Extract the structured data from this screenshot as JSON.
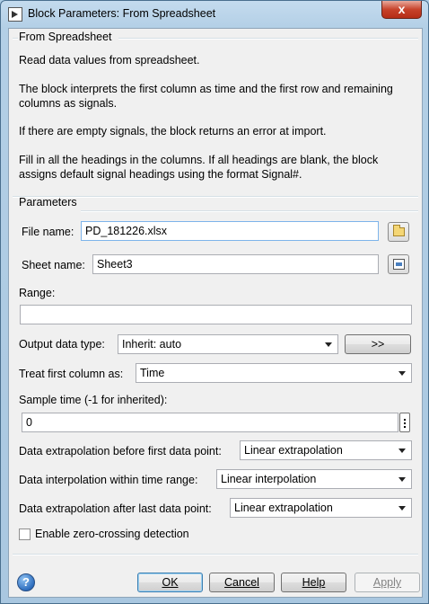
{
  "window": {
    "title": "Block Parameters: From Spreadsheet",
    "close_glyph": "x"
  },
  "block_group": {
    "title": "From Spreadsheet",
    "descriptions": [
      "Read data values from spreadsheet.",
      "The block interprets the first column as time and the first row and remaining columns as signals.",
      "If there are empty signals, the block returns an error at import.",
      "Fill in all the headings in the columns. If all headings are blank, the block assigns default signal headings using the format Signal#."
    ]
  },
  "parameters": {
    "title": "Parameters",
    "file_name_label": "File name:",
    "file_name_value": "PD_181226.xlsx",
    "sheet_name_label": "Sheet name:",
    "sheet_name_value": "Sheet3",
    "range_label": "Range:",
    "range_value": "",
    "output_type_label": "Output data type:",
    "output_type_value": "Inherit: auto",
    "output_type_button": ">>",
    "treat_first_col_label": "Treat first column as:",
    "treat_first_col_value": "Time",
    "sample_time_label": "Sample time (-1 for inherited):",
    "sample_time_value": "0",
    "extrap_before_label": "Data extrapolation before first data point:",
    "extrap_before_value": "Linear extrapolation",
    "interp_label": "Data interpolation within time range:",
    "interp_value": "Linear interpolation",
    "extrap_after_label": "Data extrapolation after last data point:",
    "extrap_after_value": "Linear extrapolation",
    "zero_crossing_label": "Enable zero-crossing detection",
    "zero_crossing_checked": false
  },
  "buttons": {
    "help_glyph": "?",
    "ok": "OK",
    "cancel": "Cancel",
    "help": "Help",
    "apply": "Apply"
  }
}
